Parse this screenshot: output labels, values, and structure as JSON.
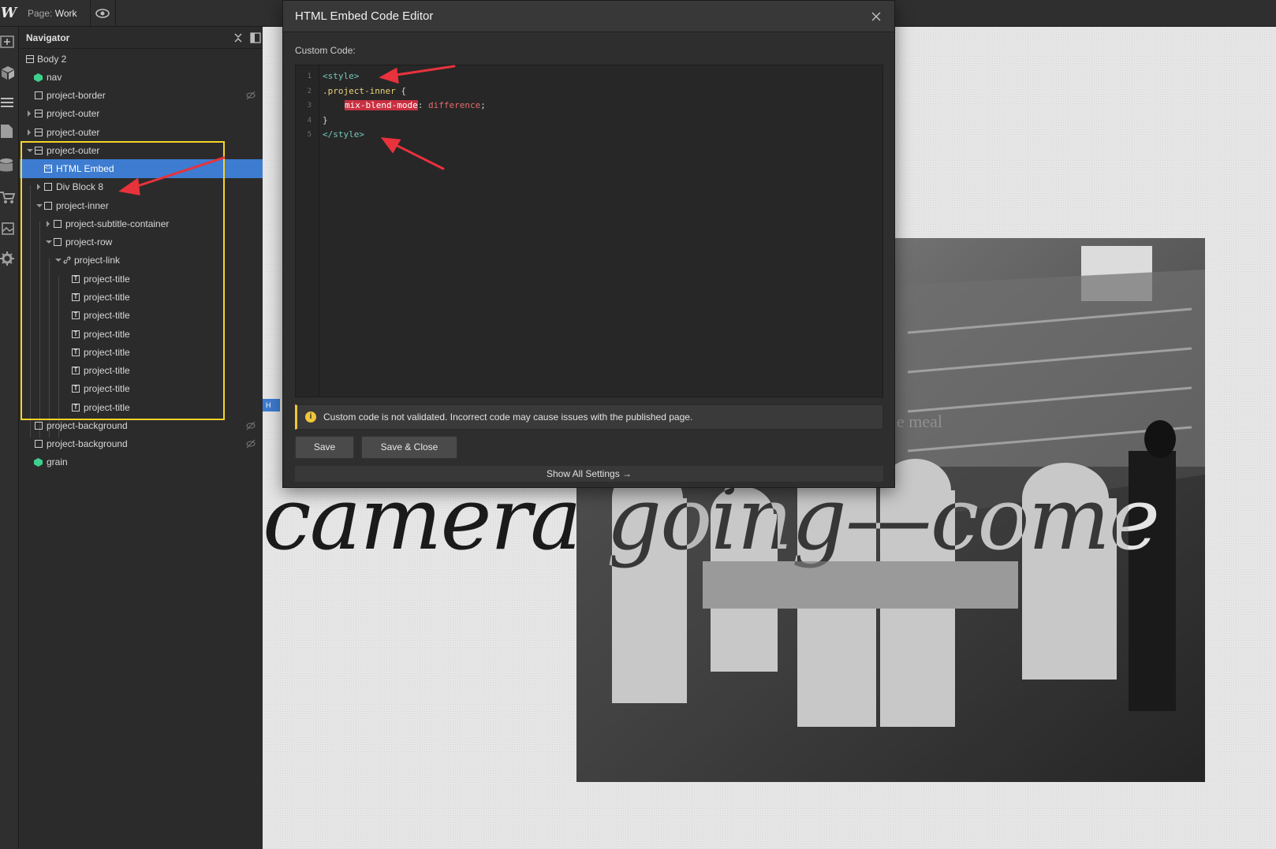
{
  "topbar": {
    "logo": "W",
    "page_prefix": "Page:",
    "page_name": "Work",
    "preview_icon": "eye-icon"
  },
  "rail": {
    "icons": [
      "add-icon",
      "cube-icon",
      "layers-icon",
      "pages-icon",
      "database-icon",
      "cart-icon",
      "assets-icon",
      "settings-icon"
    ]
  },
  "navigator": {
    "title": "Navigator",
    "items": [
      {
        "label": "Body 2"
      },
      {
        "label": "nav"
      },
      {
        "label": "project-border"
      },
      {
        "label": "project-outer"
      },
      {
        "label": "project-outer"
      },
      {
        "label": "project-outer"
      },
      {
        "label": "HTML Embed"
      },
      {
        "label": "Div Block 8"
      },
      {
        "label": "project-inner"
      },
      {
        "label": "project-subtitle-container"
      },
      {
        "label": "project-row"
      },
      {
        "label": "project-link"
      },
      {
        "label": "project-title"
      },
      {
        "label": "project-title"
      },
      {
        "label": "project-title"
      },
      {
        "label": "project-title"
      },
      {
        "label": "project-title"
      },
      {
        "label": "project-title"
      },
      {
        "label": "project-title"
      },
      {
        "label": "project-title"
      },
      {
        "label": "project-background"
      },
      {
        "label": "project-background"
      },
      {
        "label": "grain"
      }
    ]
  },
  "modal": {
    "title": "HTML Embed Code Editor",
    "custom_code_label": "Custom Code:",
    "line_numbers": [
      "1",
      "2",
      "3",
      "4",
      "5"
    ],
    "code": {
      "l1": "<style>",
      "l2_selector": ".project-inner",
      "l2_brace": " {",
      "l3_prop": "mix-blend-mode",
      "l3_colon": ": ",
      "l3_value": "difference",
      "l3_semi": ";",
      "l4": "}",
      "l5": "</style>"
    },
    "warning": "Custom code is not validated. Incorrect code may cause issues with the published page.",
    "save_label": "Save",
    "save_close_label": "Save & Close",
    "show_all_label": "Show All Settings →"
  },
  "canvas": {
    "big_text": "camera going—come",
    "small_text": "e meal",
    "embed_tag": "H"
  },
  "colors": {
    "selection": "#3d7cd0",
    "highlight_box": "#f5d328",
    "arrow": "#e8323c",
    "warning": "#f0c63a"
  }
}
